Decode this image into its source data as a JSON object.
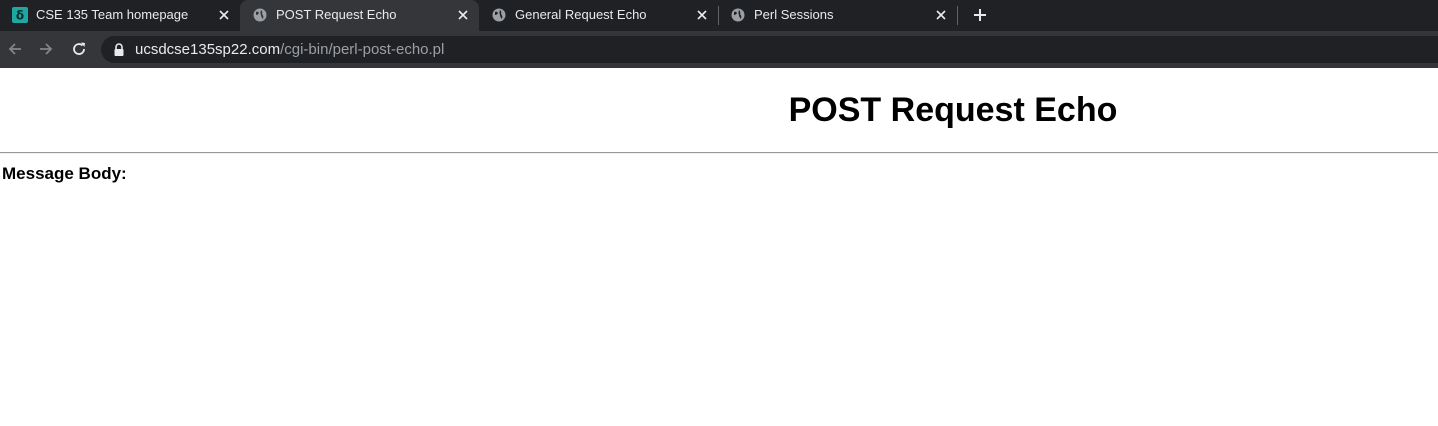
{
  "tabs": [
    {
      "title": "CSE 135 Team homepage",
      "favicon": "site-logo-icon",
      "active": false
    },
    {
      "title": "POST Request Echo",
      "favicon": "globe-icon",
      "active": true
    },
    {
      "title": "General Request Echo",
      "favicon": "globe-icon",
      "active": false
    },
    {
      "title": "Perl Sessions",
      "favicon": "globe-icon",
      "active": false
    }
  ],
  "toolbar": {
    "url_host": "ucsdcse135sp22.com",
    "url_path": "/cgi-bin/perl-post-echo.pl",
    "icons": [
      "back-arrow-icon",
      "forward-arrow-icon",
      "reload-icon",
      "lock-icon",
      "new-tab-plus-icon"
    ]
  },
  "page": {
    "heading": "POST Request Echo",
    "message_body_label": "Message Body:"
  },
  "colors": {
    "tabstrip_bg": "#202124",
    "active_tab_bg": "#35363a",
    "omnibox_bg": "#202124",
    "favicon_teal": "#1ea7a3",
    "url_host": "#e8eaed",
    "url_path": "#9aa0a6"
  }
}
